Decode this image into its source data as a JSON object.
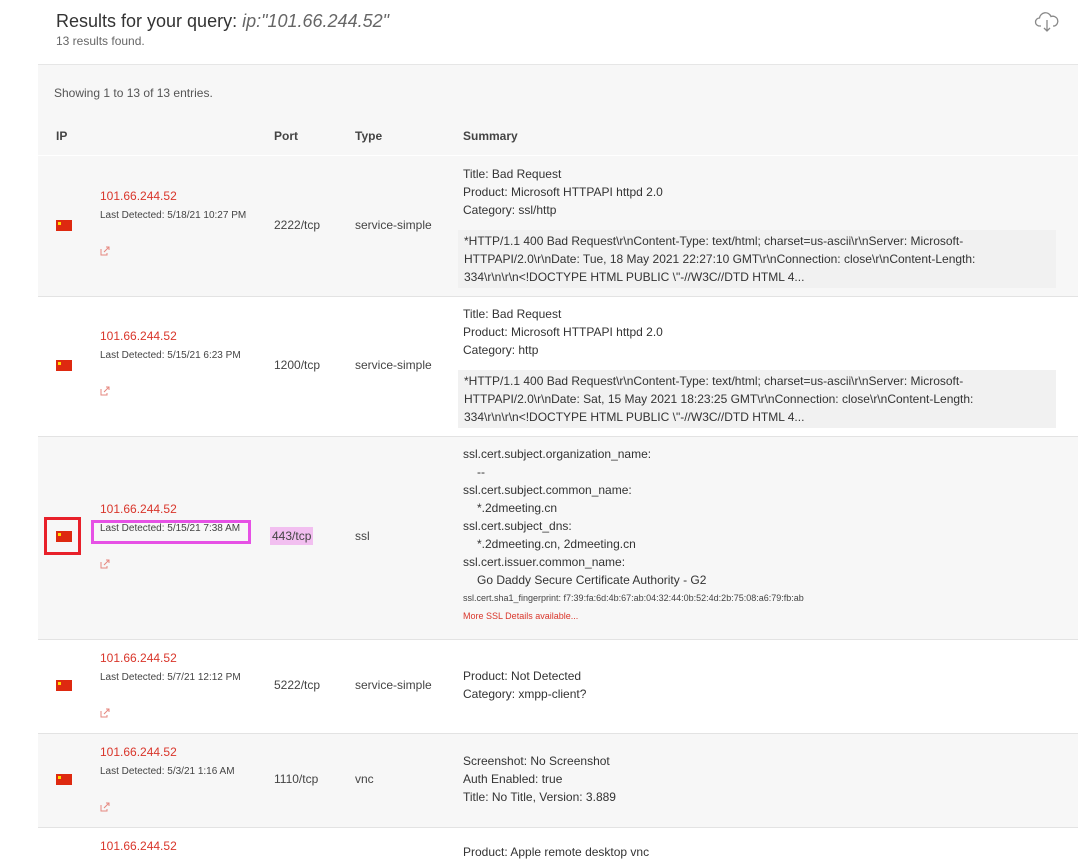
{
  "header": {
    "title_prefix": "Results for your query:",
    "query": "ip:\"101.66.244.52\"",
    "results_count": "13 results found."
  },
  "table": {
    "showing": "Showing 1 to 13 of 13 entries.",
    "columns": {
      "ip": "IP",
      "port": "Port",
      "type": "Type",
      "summary": "Summary"
    },
    "rows": [
      {
        "ip": "101.66.244.52",
        "detected": "Last Detected: 5/18/21 10:27 PM",
        "port": "2222/tcp",
        "type": "service-simple",
        "summary": [
          "Title: Bad Request",
          "Product: Microsoft HTTPAPI httpd 2.0",
          "Category: ssl/http"
        ],
        "banner": [
          "*HTTP/1.1 400 Bad Request\\r\\nContent-Type: text/html; charset=us-ascii\\r\\nServer: Microsoft-",
          "HTTPAPI/2.0\\r\\nDate: Tue, 18 May 2021 22:27:10 GMT\\r\\nConnection: close\\r\\nContent-Length:",
          "334\\r\\n\\r\\n<!DOCTYPE HTML PUBLIC \\\"-//W3C//DTD HTML 4..."
        ]
      },
      {
        "ip": "101.66.244.52",
        "detected": "Last Detected: 5/15/21 6:23 PM",
        "port": "1200/tcp",
        "type": "service-simple",
        "summary": [
          "Title: Bad Request",
          "Product: Microsoft HTTPAPI httpd 2.0",
          "Category: http"
        ],
        "banner": [
          "*HTTP/1.1 400 Bad Request\\r\\nContent-Type: text/html; charset=us-ascii\\r\\nServer: Microsoft-",
          "HTTPAPI/2.0\\r\\nDate: Sat, 15 May 2021 18:23:25 GMT\\r\\nConnection: close\\r\\nContent-Length:",
          "334\\r\\n\\r\\n<!DOCTYPE HTML PUBLIC \\\"-//W3C//DTD HTML 4..."
        ]
      },
      {
        "ip": "101.66.244.52",
        "detected": "Last Detected: 5/15/21 7:38 AM",
        "port": "443/tcp",
        "type": "ssl",
        "summary": [
          "ssl.cert.subject.organization_name:",
          "--",
          "ssl.cert.subject.common_name:",
          "*.2dmeeting.cn",
          "ssl.cert.subject_dns:",
          "*.2dmeeting.cn, 2dmeeting.cn",
          "ssl.cert.issuer.common_name:",
          "Go Daddy Secure Certificate Authority - G2"
        ],
        "fingerprint": "ssl.cert.sha1_fingerprint: f7:39:fa:6d:4b:67:ab:04:32:44:0b:52:4d:2b:75:08:a6:79:fb:ab",
        "more": "More SSL Details available..."
      },
      {
        "ip": "101.66.244.52",
        "detected": "Last Detected: 5/7/21 12:12 PM",
        "port": "5222/tcp",
        "type": "service-simple",
        "summary": [
          "Product: Not Detected",
          "Category: xmpp-client?"
        ]
      },
      {
        "ip": "101.66.244.52",
        "detected": "Last Detected: 5/3/21 1:16 AM",
        "port": "1110/tcp",
        "type": "vnc",
        "summary": [
          "Screenshot: No Screenshot",
          "Auth Enabled: true",
          "Title: No Title, Version: 3.889"
        ]
      },
      {
        "ip": "101.66.244.52",
        "summary": [
          "Product: Apple remote desktop vnc"
        ]
      }
    ]
  },
  "colors": {
    "ip_link": "#d9362b",
    "flag": "#de2910",
    "highlight_red": "#e8202a",
    "highlight_pink": "#e651e5"
  },
  "icons": {
    "flag": "china-flag-icon",
    "external": "external-link-icon",
    "download": "cloud-download-icon"
  }
}
